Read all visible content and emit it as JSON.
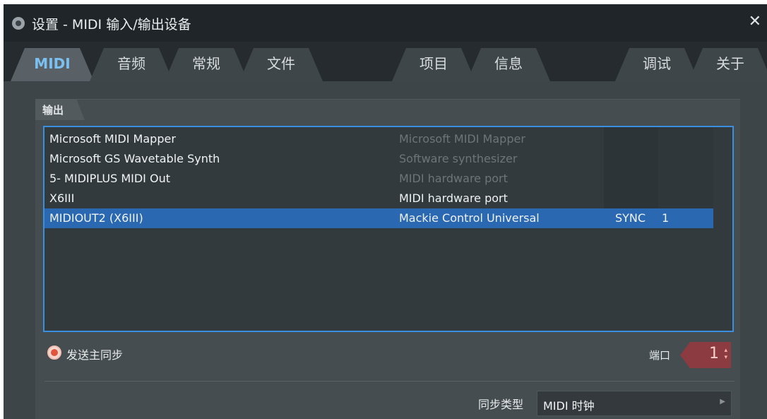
{
  "window": {
    "title": "设置 - MIDI 输入/输出设备",
    "close_glyph": "✕"
  },
  "tabs": [
    {
      "label": "MIDI",
      "active": true
    },
    {
      "label": "音频"
    },
    {
      "label": "常规"
    },
    {
      "label": "文件"
    },
    {
      "label": "项目"
    },
    {
      "label": "信息"
    },
    {
      "label": "调试"
    },
    {
      "label": "关于"
    }
  ],
  "output": {
    "section_label": "输出",
    "devices": [
      {
        "name": "Microsoft MIDI Mapper",
        "type": "Microsoft MIDI Mapper",
        "sync": "",
        "port": ""
      },
      {
        "name": "Microsoft GS Wavetable Synth",
        "type": "Software synthesizer",
        "sync": "",
        "port": ""
      },
      {
        "name": "5- MIDIPLUS MIDI Out",
        "type": "MIDI hardware port",
        "sync": "",
        "port": ""
      },
      {
        "name": "X6III",
        "type": "MIDI hardware port",
        "sync": "",
        "port": ""
      },
      {
        "name": "MIDIOUT2 (X6III)",
        "type": "Mackie Control Universal",
        "sync": "SYNC",
        "port": "1",
        "selected": true
      }
    ],
    "send_master_sync_label": "发送主同步",
    "send_master_sync": true,
    "port_label": "端口",
    "port_value": "1",
    "sync_type_label": "同步类型",
    "sync_type_value": "MIDI 时钟"
  },
  "colors": {
    "accent": "#3a8fe0",
    "selection": "#2b68b2",
    "active_tab_text": "#7ac0f0",
    "port_box": "#8c3c40",
    "radio_on": "#e0553d"
  }
}
